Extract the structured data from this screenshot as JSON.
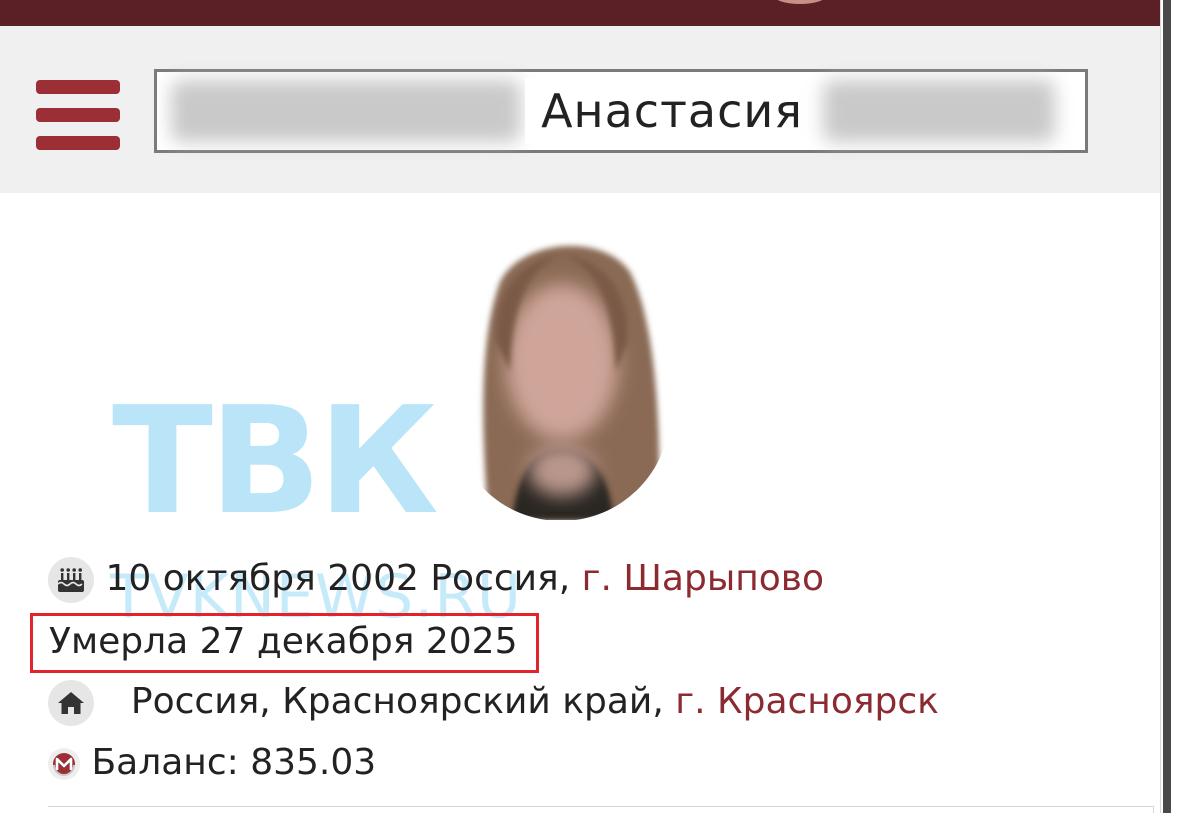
{
  "header": {
    "menu_icon": "hamburger-menu-icon",
    "name": {
      "first_name": "Анастасия"
    }
  },
  "profile": {
    "avatar": "blurred-profile-photo",
    "birth": {
      "icon": "birthday-cake-icon",
      "date": "10 октября 2002",
      "country": "Россия,",
      "city": "г. Шарыпово"
    },
    "death": {
      "text": "Умерла 27 декабря 2025"
    },
    "residence": {
      "icon": "home-icon",
      "region": "Россия, Красноярский край,",
      "city": "г. Красноярск"
    },
    "balance": {
      "icon": "currency-m-icon",
      "label": "Баланс:",
      "value": "835.03"
    }
  },
  "watermark": {
    "logo": "ТВК",
    "url": "TVKNEWS.RU"
  },
  "colors": {
    "top_bar": "#5a2025",
    "accent": "#9c2e35",
    "link": "#8c2a31",
    "highlight_frame": "#e3232b",
    "watermark": "#40b8eb"
  }
}
